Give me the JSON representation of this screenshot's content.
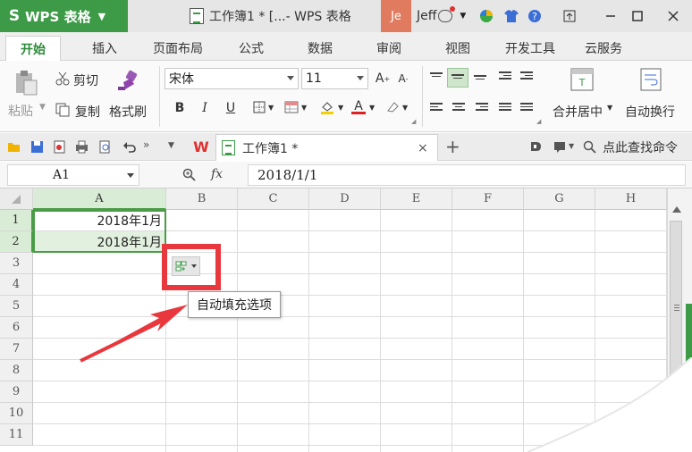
{
  "app": {
    "name": "WPS 表格",
    "logo_letter": "S",
    "window_title": "工作簿1 * [...- WPS 表格",
    "user_initials": "Je",
    "user_name": "Jeff",
    "brand_green": "#3d9b48"
  },
  "menu": {
    "tabs": [
      "开始",
      "插入",
      "页面布局",
      "公式",
      "数据",
      "审阅",
      "视图",
      "开发工具",
      "云服务"
    ],
    "active": "开始"
  },
  "ribbon": {
    "paste_label": "粘贴",
    "cut_label": "剪切",
    "copy_label": "复制",
    "format_painter_label": "格式刷",
    "font_name": "宋体",
    "font_size": "11",
    "bold": "B",
    "italic": "I",
    "underline": "U",
    "merge_label": "合并居中",
    "wrap_label": "自动换行"
  },
  "quickbar": {
    "doc_tab_label": "工作簿1 *",
    "find_command_label": "点此查找命令",
    "new_tab_symbol": "+",
    "close_symbol": "×"
  },
  "formula_bar": {
    "cell_ref": "A1",
    "fx_label": "fx",
    "value": "2018/1/1"
  },
  "sheet": {
    "columns": [
      "A",
      "B",
      "C",
      "D",
      "E",
      "F",
      "G",
      "H"
    ],
    "rows": [
      "1",
      "2",
      "3",
      "4",
      "5",
      "6",
      "7",
      "8",
      "9",
      "10",
      "11"
    ],
    "cells": {
      "A1": "2018年1月",
      "A2": "2018年1月"
    },
    "selected_range": "A1:A2"
  },
  "tooltip": {
    "autofill_options": "自动填充选项"
  },
  "annotation": {
    "highlight_color": "#e8383d"
  }
}
